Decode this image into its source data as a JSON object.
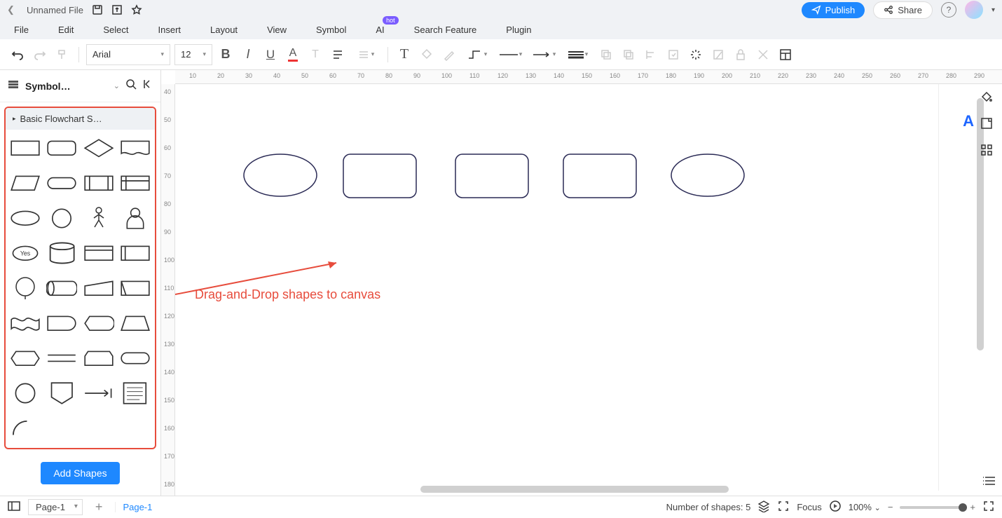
{
  "titlebar": {
    "filename": "Unnamed File",
    "publish": "Publish",
    "share": "Share"
  },
  "menubar": {
    "items": [
      "File",
      "Edit",
      "Select",
      "Insert",
      "Layout",
      "View",
      "Symbol",
      "AI",
      "Search Feature",
      "Plugin"
    ],
    "hot_badge": "hot"
  },
  "toolbar": {
    "font": "Arial",
    "font_size": "12"
  },
  "leftpanel": {
    "title": "Symbol…",
    "group_title": "Basic Flowchart S…",
    "yes_label": "Yes",
    "add_shapes": "Add Shapes"
  },
  "ruler_h": [
    10,
    20,
    30,
    40,
    50,
    60,
    70,
    80,
    90,
    100,
    110,
    120,
    130,
    140,
    150,
    160,
    170,
    180,
    190,
    200,
    210,
    220,
    230,
    240,
    250,
    260,
    270,
    280,
    290
  ],
  "ruler_v": [
    40,
    50,
    60,
    70,
    80,
    90,
    100,
    110,
    120,
    130,
    140,
    150,
    160,
    170,
    180
  ],
  "canvas": {
    "annotation": "Drag-and-Drop shapes to canvas",
    "ai_badge": "A"
  },
  "statusbar": {
    "page_select": "Page-1",
    "page_tab": "Page-1",
    "shape_count_label": "Number of shapes: 5",
    "focus": "Focus",
    "zoom": "100% ",
    "zoom_caret": "⌄"
  }
}
